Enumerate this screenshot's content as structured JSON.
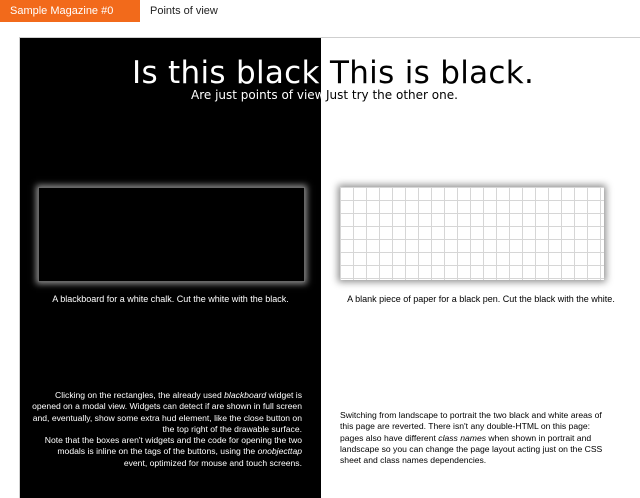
{
  "nav": {
    "active_tab": "Sample Magazine #0",
    "crumb": "Points of view"
  },
  "left": {
    "title": "Is this black?",
    "subtitle": "Are just points of view.",
    "caption": "A blackboard for a white chalk. Cut the white with the black.",
    "paragraph": {
      "p1": "Clicking on the rectangles, the already used ",
      "em1": "blackboard",
      "p2": " widget is opened on a modal view. Widgets can detect if are shown in full screen and, eventually, show some extra hud element, like the close button on the top right of the drawable surface.",
      "p3": "Note that the boxes aren't widgets and the code for opening the two modals is inline on the tags of the buttons, using the ",
      "em2": "onobjecttap",
      "p4": " event, optimized for mouse and touch screens."
    }
  },
  "right": {
    "title": "This is black.",
    "subtitle": "Just try the other one.",
    "caption": "A blank piece of paper for a black pen. Cut the black with the white.",
    "paragraph": {
      "p1": "Switching from landscape to portrait the two black and white areas of this page are reverted. There isn't any double-HTML on this page: pages also have different ",
      "em1": "class names",
      "p2": " when shown in portrait and landscape so you can change the page layout acting just on the CSS sheet and class names dependencies."
    }
  },
  "colors": {
    "accent": "#f26a1b",
    "black_side": "#000000",
    "white_side": "#ffffff"
  }
}
